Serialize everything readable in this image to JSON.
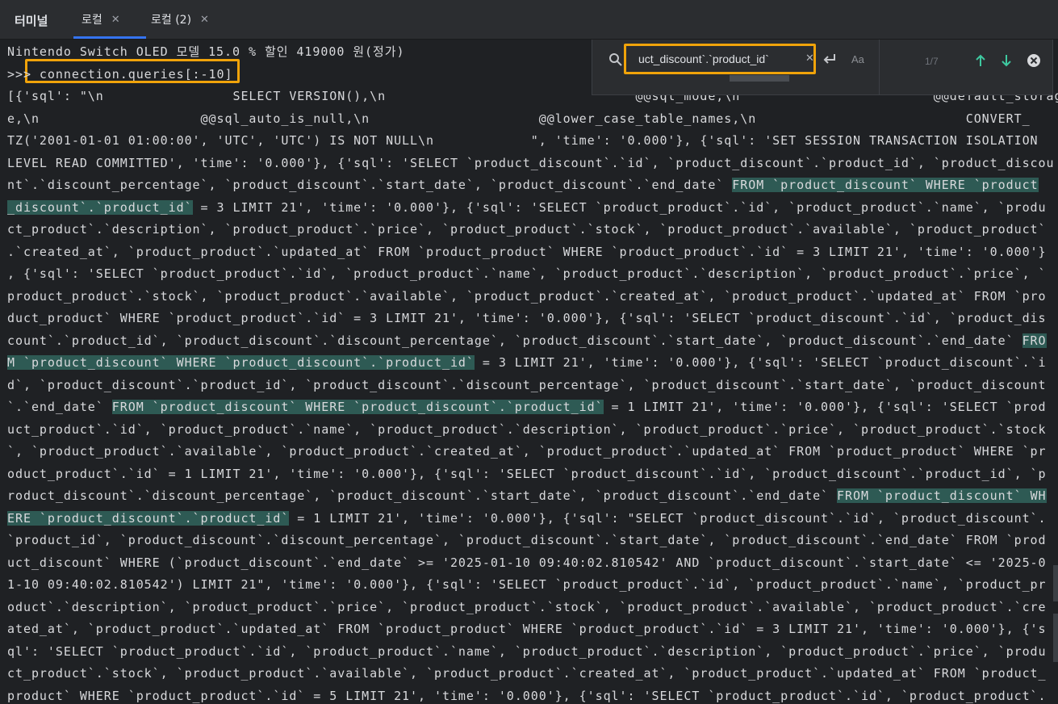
{
  "tabbar": {
    "panel_title": "터미널",
    "tabs": [
      {
        "label": "로컬",
        "active": true
      },
      {
        "label": "로컬 (2)",
        "active": false
      }
    ]
  },
  "find": {
    "query": "uct_discount`.`product_id`",
    "match_count": "1/7",
    "case_label": "Aa",
    "icons": [
      "search-icon",
      "clear-icon",
      "enter-icon",
      "match-case",
      "arrow-up-icon",
      "arrow-down-icon",
      "close-icon"
    ]
  },
  "terminal": {
    "lines": [
      [
        {
          "t": "Nintendo Switch OLED 모델 15.0 % 할인 419000 원(정가)"
        }
      ],
      [
        {
          "t": ">>> connection.queries[:-10]"
        }
      ],
      [
        {
          "t": "[{'sql': \"\\n                SELECT VERSION(),\\n                               @@sql_mode,\\n                        @@default_storage_engin"
        }
      ],
      [
        {
          "t": "e,\\n                    @@sql_auto_is_null,\\n                     @@lower_case_table_names,\\n                          CONVERT_"
        }
      ],
      [
        {
          "t": "TZ('2001-01-01 01:00:00', 'UTC', 'UTC') IS NOT NULL\\n            \", 'time': '0.000'}, {'sql': 'SET SESSION TRANSACTION ISOLATION"
        }
      ],
      [
        {
          "t": "LEVEL READ COMMITTED', 'time': '0.000'}, {'sql': 'SELECT `product_discount`.`id`, `product_discount`.`product_id`, `product_discou"
        }
      ],
      [
        {
          "t": "nt`.`discount_percentage`, `product_discount`.`start_date`, `product_discount`.`end_date` "
        },
        {
          "t": "FROM `product_discount` WHERE `product",
          "h": true
        }
      ],
      [
        {
          "t": "_discount`.`product_id`",
          "h": true
        },
        {
          "t": " = 3 LIMIT 21', 'time': '0.000'}, {'sql': 'SELECT `product_product`.`id`, `product_product`.`name`, `produ"
        }
      ],
      [
        {
          "t": "ct_product`.`description`, `product_product`.`price`, `product_product`.`stock`, `product_product`.`available`, `product_product`"
        }
      ],
      [
        {
          "t": ".`created_at`, `product_product`.`updated_at` FROM `product_product` WHERE `product_product`.`id` = 3 LIMIT 21', 'time': '0.000'}"
        }
      ],
      [
        {
          "t": ", {'sql': 'SELECT `product_product`.`id`, `product_product`.`name`, `product_product`.`description`, `product_product`.`price`, `"
        }
      ],
      [
        {
          "t": "product_product`.`stock`, `product_product`.`available`, `product_product`.`created_at`, `product_product`.`updated_at` FROM `pro"
        }
      ],
      [
        {
          "t": "duct_product` WHERE `product_product`.`id` = 3 LIMIT 21', 'time': '0.000'}, {'sql': 'SELECT `product_discount`.`id`, `product_dis"
        }
      ],
      [
        {
          "t": "count`.`product_id`, `product_discount`.`discount_percentage`, `product_discount`.`start_date`, `product_discount`.`end_date` "
        },
        {
          "t": "FRO",
          "h": true
        }
      ],
      [
        {
          "t": "M `product_discount` WHERE `product_discount`.`product_id`",
          "h": true
        },
        {
          "t": " = 3 LIMIT 21', 'time': '0.000'}, {'sql': 'SELECT `product_discount`.`i"
        }
      ],
      [
        {
          "t": "d`, `product_discount`.`product_id`, `product_discount`.`discount_percentage`, `product_discount`.`start_date`, `product_discount"
        }
      ],
      [
        {
          "t": "`.`end_date` "
        },
        {
          "t": "FROM `product_discount` WHERE `product_discount`.`product_id`",
          "h": true
        },
        {
          "t": " = 1 LIMIT 21', 'time': '0.000'}, {'sql': 'SELECT `prod"
        }
      ],
      [
        {
          "t": "uct_product`.`id`, `product_product`.`name`, `product_product`.`description`, `product_product`.`price`, `product_product`.`stock"
        }
      ],
      [
        {
          "t": "`, `product_product`.`available`, `product_product`.`created_at`, `product_product`.`updated_at` FROM `product_product` WHERE `pr"
        }
      ],
      [
        {
          "t": "oduct_product`.`id` = 1 LIMIT 21', 'time': '0.000'}, {'sql': 'SELECT `product_discount`.`id`, `product_discount`.`product_id`, `p"
        }
      ],
      [
        {
          "t": "roduct_discount`.`discount_percentage`, `product_discount`.`start_date`, `product_discount`.`end_date` "
        },
        {
          "t": "FROM `product_discount` WH",
          "h": true
        }
      ],
      [
        {
          "t": "ERE `product_discount`.`product_id`",
          "h": true
        },
        {
          "t": " = 1 LIMIT 21', 'time': '0.000'}, {'sql': \"SELECT `product_discount`.`id`, `product_discount`."
        }
      ],
      [
        {
          "t": "`product_id`, `product_discount`.`discount_percentage`, `product_discount`.`start_date`, `product_discount`.`end_date` FROM `prod"
        }
      ],
      [
        {
          "t": "uct_discount` WHERE (`product_discount`.`end_date` >= '2025-01-10 09:40:02.810542' AND `product_discount`.`start_date` <= '2025-0"
        }
      ],
      [
        {
          "t": "1-10 09:40:02.810542') LIMIT 21\", 'time': '0.000'}, {'sql': 'SELECT `product_product`.`id`, `product_product`.`name`, `product_pr"
        }
      ],
      [
        {
          "t": "oduct`.`description`, `product_product`.`price`, `product_product`.`stock`, `product_product`.`available`, `product_product`.`cre"
        }
      ],
      [
        {
          "t": "ated_at`, `product_product`.`updated_at` FROM `product_product` WHERE `product_product`.`id` = 3 LIMIT 21', 'time': '0.000'}, {'s"
        }
      ],
      [
        {
          "t": "ql': 'SELECT `product_product`.`id`, `product_product`.`name`, `product_product`.`description`, `product_product`.`price`, `produ"
        }
      ],
      [
        {
          "t": "ct_product`.`stock`, `product_product`.`available`, `product_product`.`created_at`, `product_product`.`updated_at` FROM `product_"
        }
      ],
      [
        {
          "t": "product` WHERE `product_product`.`id` = 5 LIMIT 21', 'time': '0.000'}, {'sql': 'SELECT `product_product`.`id`, `product_product`."
        }
      ]
    ]
  },
  "colors": {
    "background": "#1f2124",
    "text": "#d8d9dc",
    "match_highlight": "#2e5a54",
    "annotation_box": "#f0a30a",
    "active_tab_underline": "#3574f0"
  }
}
